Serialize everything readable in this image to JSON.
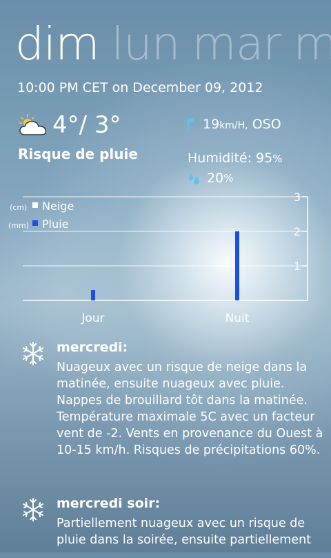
{
  "pivot": {
    "tabs": [
      {
        "label": "dim"
      },
      {
        "label": "lun"
      },
      {
        "label": "mar"
      },
      {
        "label": "m"
      }
    ]
  },
  "current": {
    "datetime": "10:00 PM CET on December 09, 2012",
    "temps": "4°/ 3°",
    "condition": "Risque de pluie",
    "condition_icon": "partly-cloudy-icon",
    "wind_speed": "19",
    "wind_unit": "km/H,",
    "wind_dir": "OSO",
    "humidity_label": "Humidité:",
    "humidity_value": "95",
    "humidity_unit": "%",
    "precip_value": "20",
    "precip_unit": "%"
  },
  "legend": {
    "snow_unit": "(cm)",
    "snow_label": "Neige",
    "rain_unit": "(mm)",
    "rain_label": "Pluie"
  },
  "chart_data": {
    "type": "bar",
    "categories": [
      "Jour",
      "Nuit"
    ],
    "series": [
      {
        "name": "Neige",
        "unit": "cm",
        "values": [
          0,
          0
        ],
        "color": "#ffffff"
      },
      {
        "name": "Pluie",
        "unit": "mm",
        "values": [
          0.3,
          2.0
        ],
        "color": "#1a4fe8"
      }
    ],
    "yticks": [
      1,
      2,
      3
    ],
    "ylim": [
      0,
      3
    ],
    "grid": true
  },
  "forecast": [
    {
      "title": "mercredi:",
      "icon": "snowflake-icon",
      "text": "Nuageux avec un risque de neige dans la matinée, ensuite nuageux avec pluie. Nappes de brouillard tôt dans la matinée. Température maximale 5C avec un facteur vent de -2. Vents en provenance du Ouest à 10-15 km/h. Risques de précipitations 60%."
    },
    {
      "title": "mercredi soir:",
      "icon": "snowflake-icon",
      "text": "Partiellement nuageux avec un risque de pluie dans la soirée, ensuite partiellement"
    }
  ],
  "colors": {
    "rain_bar": "#1a4fe8",
    "flag": "#5fc3e8",
    "drop": "#5fc3e8"
  }
}
